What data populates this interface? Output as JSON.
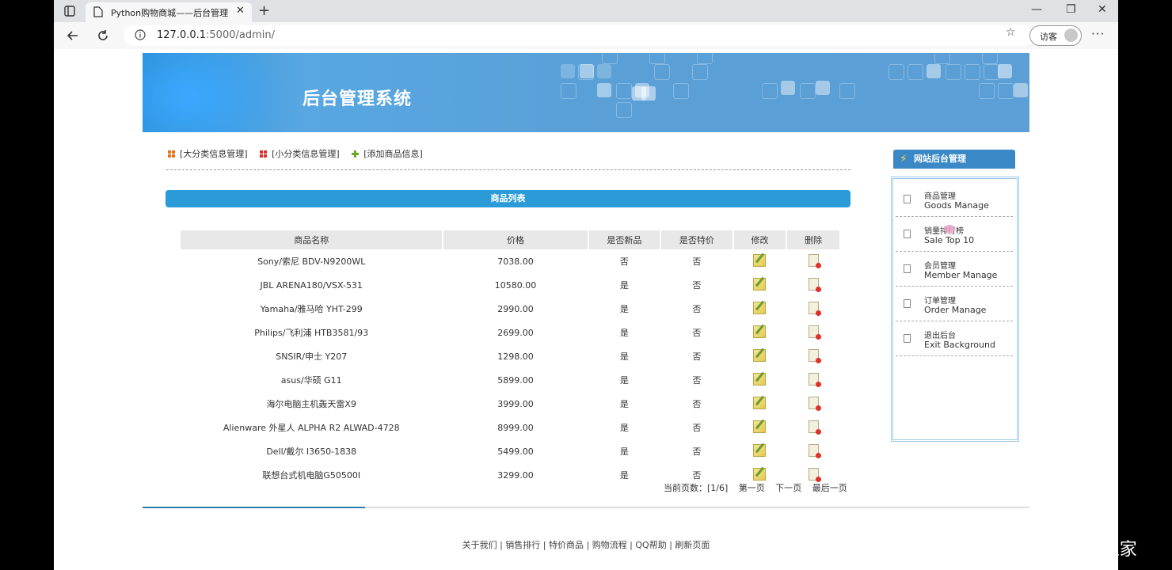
{
  "browser": {
    "tab_title": "Python购物商城——后台管理",
    "url_host": "127.0.0.1",
    "url_path": ":5000/admin/",
    "guest_label": "访客"
  },
  "banner": {
    "title": "后台管理系统"
  },
  "top_links": {
    "category_big": "[大分类信息管理]",
    "category_small": "[小分类信息管理]",
    "add_goods": "[添加商品信息]"
  },
  "goods_list": {
    "header": "商品列表",
    "columns": [
      "商品名称",
      "价格",
      "是否新品",
      "是否特价",
      "修改",
      "删除"
    ],
    "rows": [
      {
        "name": "Sony/索尼 BDV-N9200WL",
        "price": "7038.00",
        "is_new": "否",
        "is_special": "否"
      },
      {
        "name": "JBL ARENA180/VSX-531",
        "price": "10580.00",
        "is_new": "是",
        "is_special": "否"
      },
      {
        "name": "Yamaha/雅马哈 YHT-299",
        "price": "2990.00",
        "is_new": "是",
        "is_special": "否"
      },
      {
        "name": "Philips/飞利浦 HTB3581/93",
        "price": "2699.00",
        "is_new": "是",
        "is_special": "否"
      },
      {
        "name": "SNSIR/申士 Y207",
        "price": "1298.00",
        "is_new": "是",
        "is_special": "否"
      },
      {
        "name": "asus/华硕 G11",
        "price": "5899.00",
        "is_new": "是",
        "is_special": "否"
      },
      {
        "name": "海尔电脑主机轰天雷X9",
        "price": "3999.00",
        "is_new": "是",
        "is_special": "否"
      },
      {
        "name": "Alienware 外星人 ALPHA R2 ALWAD-4728",
        "price": "8999.00",
        "is_new": "是",
        "is_special": "否"
      },
      {
        "name": "Dell/戴尔 I3650-1838",
        "price": "5499.00",
        "is_new": "是",
        "is_special": "否"
      },
      {
        "name": "联想台式机电脑G50500I",
        "price": "3299.00",
        "is_new": "是",
        "is_special": "否"
      }
    ]
  },
  "pager": {
    "current_label": "当前页数：[1/6]",
    "first": "第一页",
    "next": "下一页",
    "last": "最后一页"
  },
  "footer": {
    "links": "关于我们 | 销售排行 | 特价商品 | 购物流程 | QQ帮助 | 刷新页面"
  },
  "sidebar": {
    "title": "网站后台管理",
    "items": [
      {
        "cn": "商品管理",
        "en": "Goods Manage"
      },
      {
        "cn": "销量排行榜",
        "en": "Sale Top 10"
      },
      {
        "cn": "会员管理",
        "en": "Member Manage"
      },
      {
        "cn": "订单管理",
        "en": "Order Manage"
      },
      {
        "cn": "退出后台",
        "en": "Exit Background"
      }
    ]
  },
  "watermark": "CSDN @源码之家",
  "icons": {
    "edit": "edit-icon",
    "delete": "delete-icon",
    "grid_orange": "grid-icon",
    "plus": "plus-icon"
  },
  "colors": {
    "banner": "#5a9fd6",
    "list_header": "#2a9bd6",
    "side_head": "#3a88c6"
  }
}
